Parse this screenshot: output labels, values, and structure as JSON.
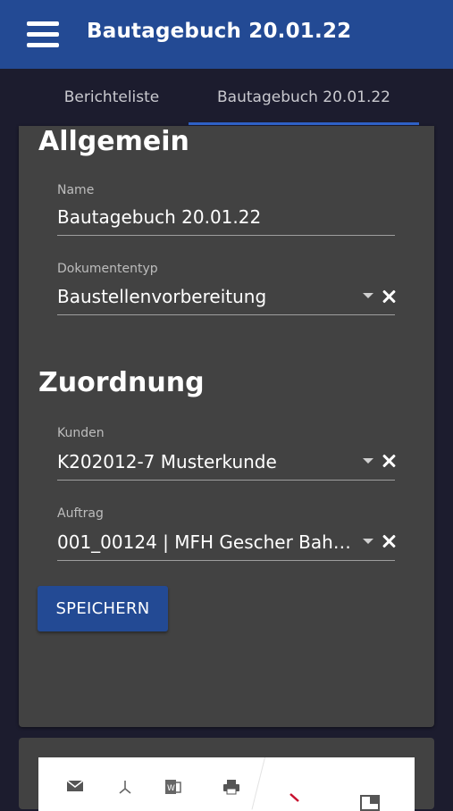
{
  "appbar": {
    "title": "Bautagebuch 20.01.22",
    "menu_icon": "hamburger-menu-icon"
  },
  "tabs": [
    {
      "label": "Berichteliste",
      "active": false
    },
    {
      "label": "Bautagebuch 20.01.22",
      "active": true
    }
  ],
  "sections": {
    "general": {
      "title": "Allgemein"
    },
    "assignment": {
      "title": "Zuordnung"
    }
  },
  "fields": {
    "name": {
      "label": "Name",
      "value": "Bautagebuch 20.01.22"
    },
    "doctype": {
      "label": "Dokumententyp",
      "value": "Baustellenvorbereitung"
    },
    "customer": {
      "label": "Kunden",
      "value": "K202012-7 Musterkunde"
    },
    "order": {
      "label": "Auftrag",
      "value": "001_00124 | MFH Gescher Bahn..."
    }
  },
  "save_button": {
    "label": "SPEICHERN"
  },
  "colors": {
    "primary": "#234a94",
    "background": "#1c1c2e",
    "card": "#424242",
    "tab_indicator": "#2f62c8"
  },
  "preview_toolbar_icons": [
    "mail-icon",
    "pdf-icon",
    "word-icon",
    "print-icon",
    "collapse-icon",
    "layout-icon"
  ]
}
